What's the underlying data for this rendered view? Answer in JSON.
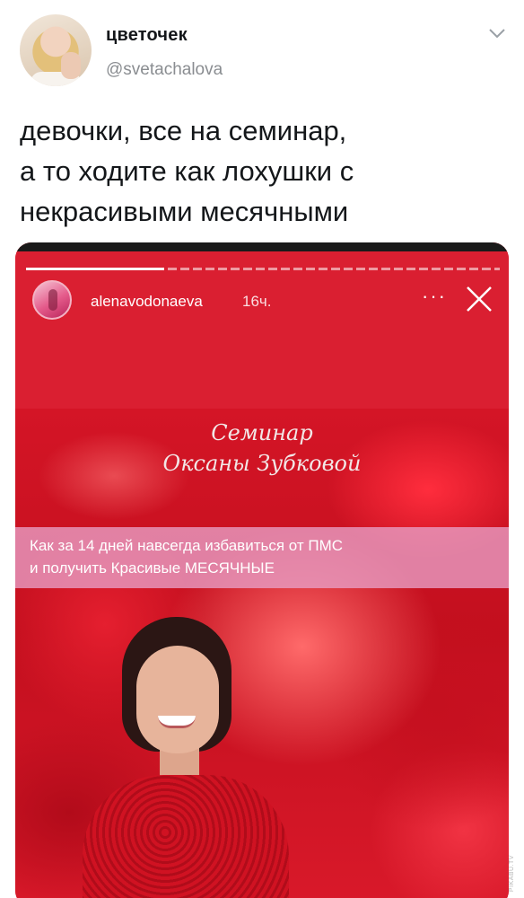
{
  "tweet": {
    "author_name": "цветочек",
    "author_handle": "@svetachalova",
    "text_lines": [
      "девочки, все на семинар,",
      "а то ходите как лохушки с",
      "некрасивыми месячными"
    ]
  },
  "story": {
    "username": "alenavodonaeva",
    "time": "16ч.",
    "more_label": "···",
    "title_line1": "Семинар",
    "title_line2": "Оксаны Зубковой",
    "banner_lines": [
      "Как за 14 дней навсегда избавиться от ПМС",
      "и получить Красивые МЕСЯЧНЫЕ"
    ]
  },
  "watermark": "PIKABU.TV",
  "icons": {
    "menu": "chevron-down-icon",
    "close": "close-icon",
    "more": "more-icon"
  },
  "colors": {
    "story_red": "#da1f31",
    "banner_pink": "#e8a0c8",
    "handle_gray": "#8a8d91"
  }
}
